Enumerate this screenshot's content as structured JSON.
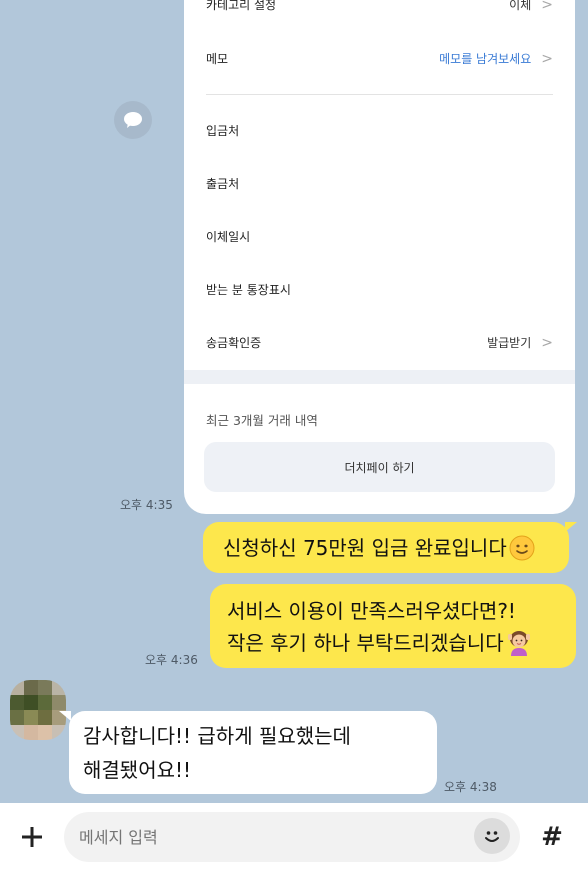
{
  "transaction_card": {
    "rows": [
      {
        "label": "카테고리 설정",
        "value": "이체"
      },
      {
        "label": "메모",
        "value": "메모를 남겨보세요"
      },
      {
        "label": "입금처",
        "value": ""
      },
      {
        "label": "출금처",
        "value": ""
      },
      {
        "label": "이체일시",
        "value": ""
      },
      {
        "label": "받는 분 통장표시",
        "value": ""
      },
      {
        "label": "송금확인증",
        "value": "발급받기"
      }
    ],
    "recent_label": "최근 3개월 거래 내역",
    "dutch_pay_button": "더치페이 하기",
    "chevron": ">"
  },
  "messages": {
    "card_time": "오후 4:35",
    "sent_1": "신청하신 75만원 입금 완료입니다",
    "sent_2_line1": "서비스 이용이 만족스러우셨다면?!",
    "sent_2_line2": "작은 후기 하나 부탁드리겠습니다",
    "sent_time": "오후 4:36",
    "recv_line1": "감사합니다!! 급하게 필요했는데",
    "recv_line2": "해결됐어요!!",
    "recv_time": "오후 4:38"
  },
  "input_bar": {
    "placeholder": "메세지 입력",
    "plus": "+",
    "hash": "#"
  },
  "colors": {
    "background": "#b2c7da",
    "sent_bubble": "#fde74c",
    "link": "#3a7bd5"
  },
  "icons": [
    "speech-bubble-icon",
    "smiley-emoji-icon",
    "girl-emoji-icon",
    "plus-icon",
    "emoji-face-icon",
    "hash-icon",
    "chevron-right-icon"
  ]
}
